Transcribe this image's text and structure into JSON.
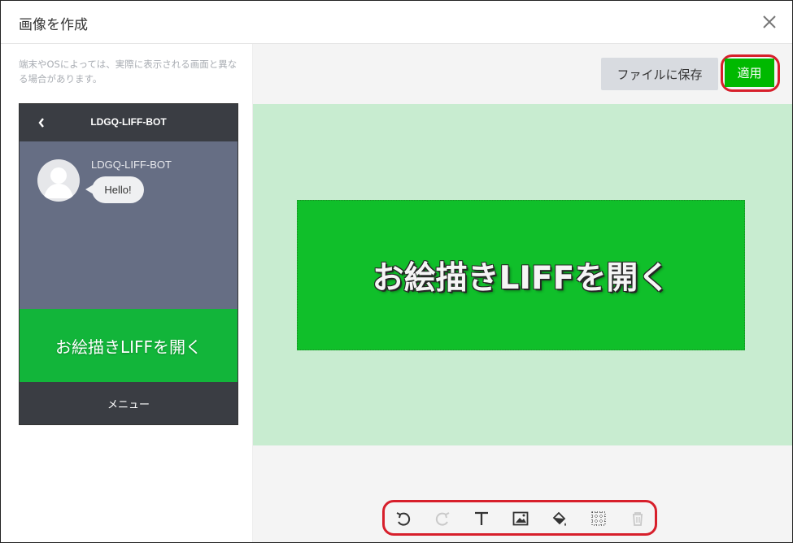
{
  "dialog": {
    "title": "画像を作成",
    "close_icon": "close-icon"
  },
  "left_panel": {
    "note": "端末やOSによっては、実際に表示される画面と異なる場合があります。",
    "phone": {
      "header": "LDGQ-LIFF-BOT",
      "sender": "LDGQ-LIFF-BOT",
      "message": "Hello!",
      "menu_button": "お絵描きLIFFを開く",
      "menu_label": "メニュー",
      "back_icon": "chevron-left-icon",
      "avatar_icon": "avatar-icon"
    }
  },
  "right_panel": {
    "save_button": "ファイルに保存",
    "apply_button": "適用",
    "canvas_text": "お絵描きLIFFを開く",
    "toolbar": [
      {
        "name": "undo-icon"
      },
      {
        "name": "redo-icon"
      },
      {
        "name": "text-icon"
      },
      {
        "name": "image-icon"
      },
      {
        "name": "fill-icon"
      },
      {
        "name": "grid-icon"
      },
      {
        "name": "trash-icon"
      }
    ]
  },
  "colors": {
    "line_green": "#00b900",
    "highlight_red": "#d71f2b",
    "canvas_bg": "#c8ecd0"
  }
}
